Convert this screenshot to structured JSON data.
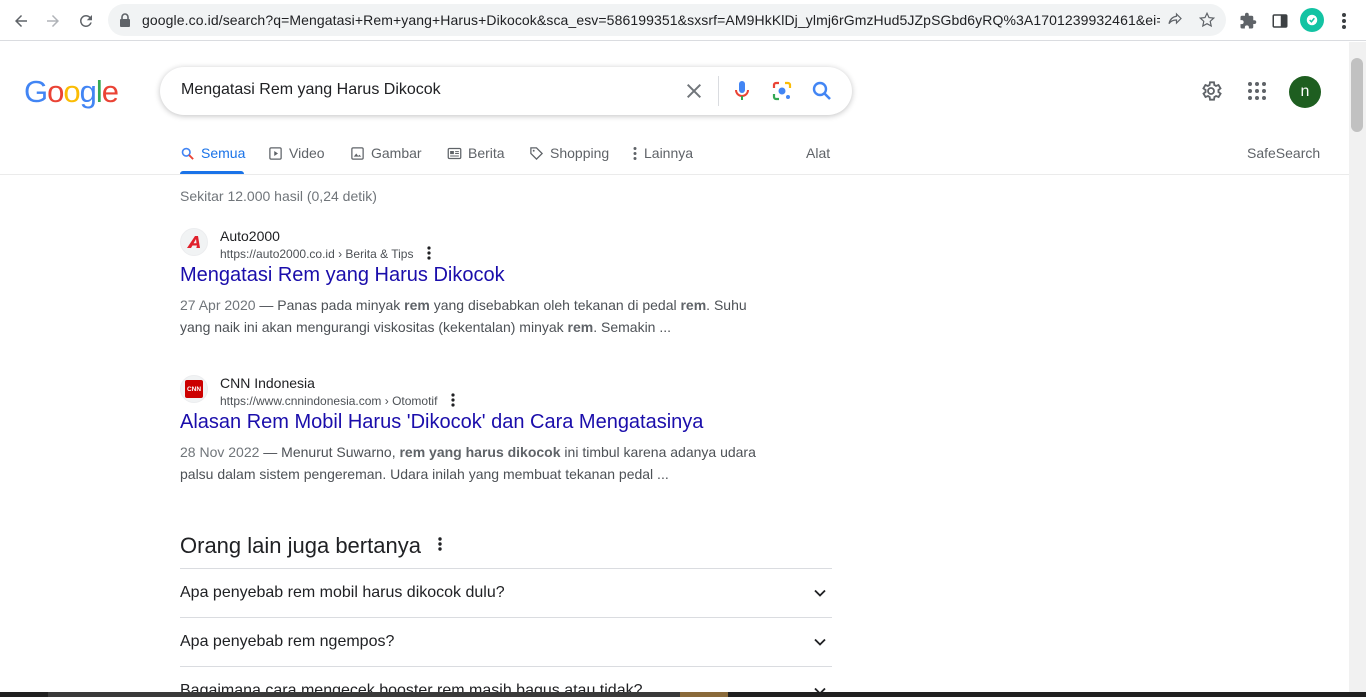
{
  "browser": {
    "url": "google.co.id/search?q=Mengatasi+Rem+yang+Harus+Dikocok&sca_esv=586199351&sxsrf=AM9HkKlDj_ylmj6rGmzHud5JZpSGbd6yRQ%3A1701239932461&ei=f..."
  },
  "header": {
    "logo_letters": [
      "G",
      "o",
      "o",
      "g",
      "l",
      "e"
    ],
    "logo_colors": [
      "#4285F4",
      "#EA4335",
      "#FBBC05",
      "#4285F4",
      "#34A853",
      "#EA4335"
    ],
    "query": "Mengatasi Rem yang Harus Dikocok",
    "avatar_initial": "n"
  },
  "tabs": {
    "all": "Semua",
    "video": "Video",
    "images": "Gambar",
    "news": "Berita",
    "shopping": "Shopping",
    "more": "Lainnya",
    "tools": "Alat",
    "safesearch": "SafeSearch"
  },
  "stats": "Sekitar 12.000 hasil (0,24 detik)",
  "results": [
    {
      "site": "Auto2000",
      "url": "https://auto2000.co.id › Berita & Tips",
      "title": "Mengatasi Rem yang Harus Dikocok",
      "date": "27 Apr 2020",
      "snippet_html": " — Panas pada minyak <b>rem</b> yang disebabkan oleh tekanan di pedal <b>rem</b>. Suhu yang naik ini akan mengurangi viskositas (kekentalan) minyak <b>rem</b>. Semakin ..."
    },
    {
      "site": "CNN Indonesia",
      "url": "https://www.cnnindonesia.com › Otomotif",
      "title": "Alasan Rem Mobil Harus 'Dikocok' dan Cara Mengatasinya",
      "date": "28 Nov 2022",
      "snippet_html": " — Menurut Suwarno, <b>rem yang harus dikocok</b> ini timbul karena adanya udara palsu dalam sistem pengereman. Udara inilah yang membuat tekanan pedal ..."
    }
  ],
  "paa": {
    "title": "Orang lain juga bertanya",
    "questions": [
      "Apa penyebab rem mobil harus dikocok dulu?",
      "Apa penyebab rem ngempos?",
      "Bagaimana cara mengecek booster rem masih bagus atau tidak?"
    ]
  },
  "colors": {
    "accent": "#1a73e8",
    "link": "#1a0dab"
  }
}
